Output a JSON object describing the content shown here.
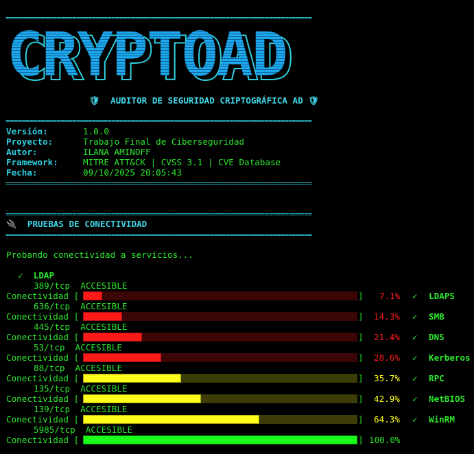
{
  "separator": "==============================================================================",
  "logo": {
    "text": "CRYPTOAD"
  },
  "subtitle": {
    "icon_left": "shield-icon",
    "text": "AUDITOR DE SEGURIDAD CRIPTOGRÁFICA AD",
    "icon_right": "shield-icon"
  },
  "info": [
    {
      "label": "Versión:",
      "value": "1.0.0"
    },
    {
      "label": "Proyecto:",
      "value": "Trabajo Final de Ciberseguridad"
    },
    {
      "label": "Autor:",
      "value": "ILANA AMINOFF"
    },
    {
      "label": "Framework:",
      "value": "MITRE ATT&CK | CVSS 3.1 | CVE Database"
    },
    {
      "label": "Fecha:",
      "value": "09/10/2025 20:05:43"
    }
  ],
  "section": {
    "icon": "plug-icon",
    "title": "PRUEBAS DE CONECTIVIDAD"
  },
  "probing": "Probando conectividad a servicios...",
  "first_service": {
    "check": "✓",
    "name": "LDAP"
  },
  "connectivity_label": "Conectividad",
  "rows": [
    {
      "port": "389/tcp",
      "status": "ACCESIBLE",
      "progress": 7.1,
      "pct": "7.1%",
      "color": "#ff1a1a",
      "next_check": "✓",
      "next_service": "LDAPS"
    },
    {
      "port": "636/tcp",
      "status": "ACCESIBLE",
      "progress": 14.3,
      "pct": "14.3%",
      "color": "#ff1a1a",
      "next_check": "✓",
      "next_service": "SMB"
    },
    {
      "port": "445/tcp",
      "status": "ACCESIBLE",
      "progress": 21.4,
      "pct": "21.4%",
      "color": "#ff1a1a",
      "next_check": "✓",
      "next_service": "DNS"
    },
    {
      "port": "53/tcp",
      "status": "ACCESIBLE",
      "progress": 28.6,
      "pct": "28.6%",
      "color": "#ff1a1a",
      "next_check": "✓",
      "next_service": "Kerberos"
    },
    {
      "port": "88/tcp",
      "status": "ACCESIBLE",
      "progress": 35.7,
      "pct": "35.7%",
      "color": "#ffff1a",
      "next_check": "✓",
      "next_service": "RPC"
    },
    {
      "port": "135/tcp",
      "status": "ACCESIBLE",
      "progress": 42.9,
      "pct": "42.9%",
      "color": "#ffff1a",
      "next_check": "✓",
      "next_service": "NetBIOS"
    },
    {
      "port": "139/tcp",
      "status": "ACCESIBLE",
      "progress": 64.3,
      "pct": "64.3%",
      "color": "#ffff1a",
      "next_check": "✓",
      "next_service": "WinRM"
    },
    {
      "port": "5985/tcp",
      "status": "ACCESIBLE",
      "progress": 100.0,
      "pct": "100.0%",
      "color": "#1aff1a",
      "next_check": "",
      "next_service": ""
    }
  ],
  "colors": {
    "cyan": "#3fd6e6",
    "green": "#2ee62e",
    "red": "#ff1a1a",
    "yellow": "#ffff1a",
    "bright_green": "#1aff1a",
    "logo_blue": "#1ea8f0"
  }
}
